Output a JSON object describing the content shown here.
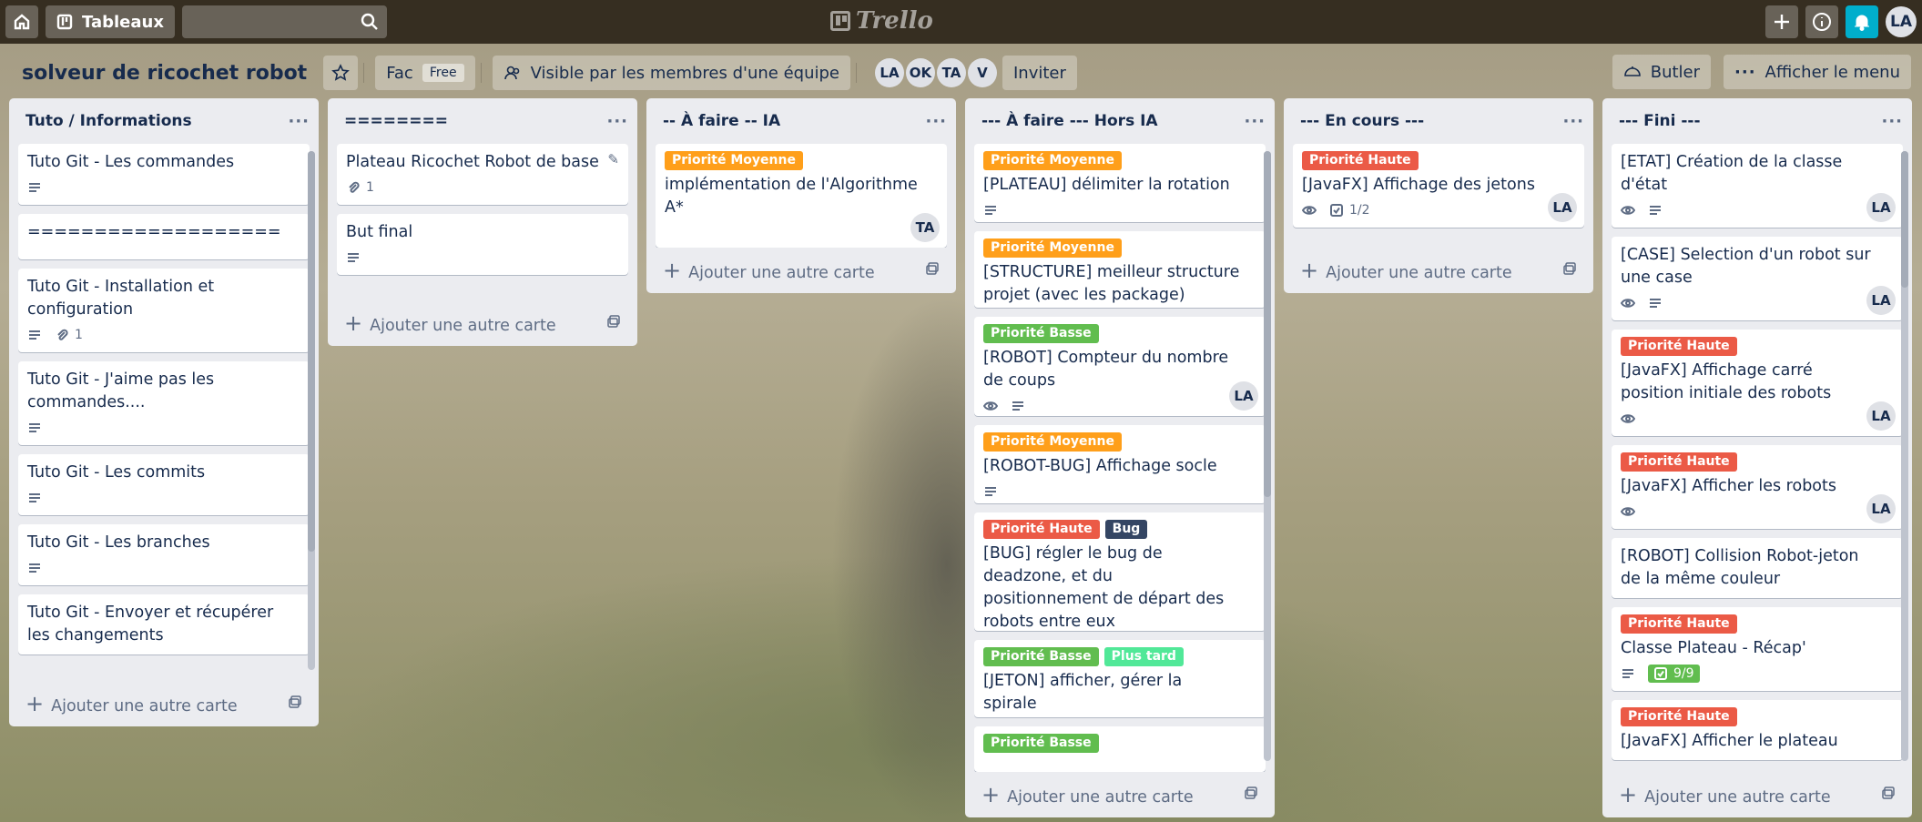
{
  "topbar": {
    "boards_label": "Tableaux",
    "search_value": "",
    "logo_text": "Trello",
    "avatar": "LA"
  },
  "board": {
    "title": "solveur de ricochet robot",
    "team_label": "Fac",
    "plan_badge": "Free",
    "visibility_label": "Visible par les membres d'une équipe",
    "members": [
      "LA",
      "OK",
      "TA",
      "V"
    ],
    "invite_label": "Inviter",
    "butler_label": "Butler",
    "menu_label": "Afficher le menu"
  },
  "colors": {
    "green": "#61bd4f",
    "orange": "#ff9f1a",
    "red": "#eb5a46",
    "navy": "#344563",
    "lime": "#51e898"
  },
  "add_card_label": "Ajouter une autre carte",
  "lists": [
    {
      "title": "Tuto / Informations",
      "cards": [
        {
          "title": "Tuto Git - Les commandes",
          "desc": true
        },
        {
          "title": "==================="
        },
        {
          "title": "Tuto Git - Installation et configuration",
          "desc": true,
          "attachments": "1"
        },
        {
          "title": "Tuto Git - J'aime pas les commandes....",
          "desc": true
        },
        {
          "title": "Tuto Git - Les commits",
          "desc": true
        },
        {
          "title": "Tuto Git - Les branches",
          "desc": true
        },
        {
          "title": "Tuto Git - Envoyer et récupérer les changements"
        }
      ]
    },
    {
      "title": "========",
      "cards": [
        {
          "title": "Plateau Ricochet Robot de base",
          "attachments": "1",
          "edit": true
        },
        {
          "title": "But final",
          "desc": true
        }
      ]
    },
    {
      "title": "-- À faire -- IA",
      "cards": [
        {
          "labels": [
            {
              "text": "Priorité Moyenne",
              "color": "#ff9f1a"
            }
          ],
          "title": "implémentation de l'Algorithme A*",
          "member": "TA"
        }
      ]
    },
    {
      "title": "--- À faire --- Hors IA",
      "cards": [
        {
          "labels": [
            {
              "text": "Priorité Moyenne",
              "color": "#ff9f1a"
            }
          ],
          "title": "[PLATEAU] délimiter la rotation",
          "desc": true
        },
        {
          "labels": [
            {
              "text": "Priorité Moyenne",
              "color": "#ff9f1a"
            }
          ],
          "title": "[STRUCTURE] meilleur structure projet (avec les package)"
        },
        {
          "labels": [
            {
              "text": "Priorité Basse",
              "color": "#61bd4f"
            }
          ],
          "title": "[ROBOT] Compteur du nombre de coups",
          "watch": true,
          "desc": true,
          "member": "LA"
        },
        {
          "labels": [
            {
              "text": "Priorité Moyenne",
              "color": "#ff9f1a"
            }
          ],
          "title": "[ROBOT-BUG] Affichage socle",
          "desc": true
        },
        {
          "labels": [
            {
              "text": "Priorité Haute",
              "color": "#eb5a46"
            },
            {
              "text": "Bug",
              "color": "#344563"
            }
          ],
          "title": "[BUG] régler le bug de deadzone, et du positionnement de départ des robots entre eux"
        },
        {
          "labels": [
            {
              "text": "Priorité Basse",
              "color": "#61bd4f"
            },
            {
              "text": "Plus tard",
              "color": "#51e898"
            }
          ],
          "title": "[JETON] afficher, gérer la spirale"
        },
        {
          "labels": [
            {
              "text": "Priorité Basse",
              "color": "#61bd4f"
            }
          ],
          "title": ""
        }
      ]
    },
    {
      "title": "--- En cours ---",
      "cards": [
        {
          "labels": [
            {
              "text": "Priorité Haute",
              "color": "#eb5a46"
            }
          ],
          "title": "[JavaFX] Affichage des jetons",
          "watch": true,
          "checklist": "1/2",
          "member": "LA"
        }
      ]
    },
    {
      "title": "--- Fini ---",
      "cards": [
        {
          "title": "[ETAT] Création de la classe d'état",
          "watch": true,
          "desc": true,
          "member": "LA"
        },
        {
          "title": "[CASE] Selection d'un robot sur une case",
          "watch": true,
          "desc": true,
          "member": "LA"
        },
        {
          "labels": [
            {
              "text": "Priorité Haute",
              "color": "#eb5a46"
            }
          ],
          "title": "[JavaFX] Affichage carré position initiale des robots",
          "watch": true,
          "member": "LA"
        },
        {
          "labels": [
            {
              "text": "Priorité Haute",
              "color": "#eb5a46"
            }
          ],
          "title": "[JavaFX] Afficher les robots",
          "watch": true,
          "member": "LA"
        },
        {
          "title": "[ROBOT] Collision Robot-jeton de la même couleur"
        },
        {
          "labels": [
            {
              "text": "Priorité Haute",
              "color": "#eb5a46"
            }
          ],
          "title": "Classe Plateau - Récap'",
          "desc": true,
          "checklist_done": "9/9"
        },
        {
          "labels": [
            {
              "text": "Priorité Haute",
              "color": "#eb5a46"
            }
          ],
          "title": "[JavaFX] Afficher le plateau"
        }
      ]
    }
  ]
}
